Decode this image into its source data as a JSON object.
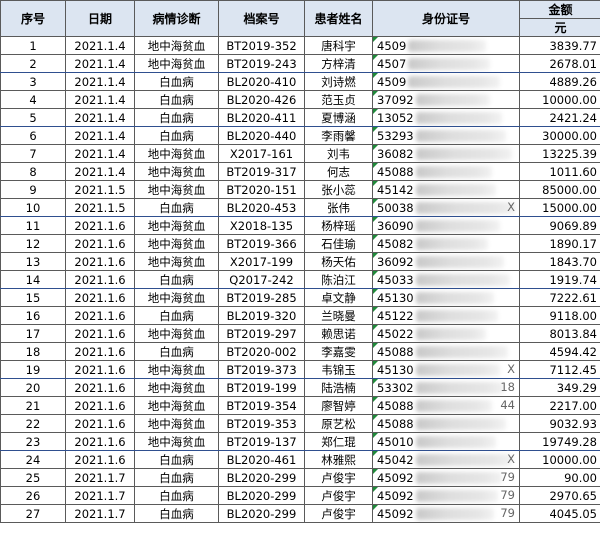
{
  "headers": {
    "seq": "序号",
    "date": "日期",
    "diagnosis": "病情诊断",
    "file_no": "档案号",
    "patient": "患者姓名",
    "id_number": "身份证号",
    "amount": "金额",
    "amount_unit": "元"
  },
  "rows": [
    {
      "seq": "1",
      "date": "2021.1.4",
      "diagnosis": "地中海贫血",
      "file_no": "BT2019-352",
      "patient": "唐科宇",
      "id_prefix": "4509",
      "id_tail": "",
      "amount": "3839.77"
    },
    {
      "seq": "2",
      "date": "2021.1.4",
      "diagnosis": "地中海贫血",
      "file_no": "BT2019-243",
      "patient": "方梓清",
      "id_prefix": "4507",
      "id_tail": "",
      "amount": "2678.01"
    },
    {
      "seq": "3",
      "date": "2021.1.4",
      "diagnosis": "白血病",
      "file_no": "BL2020-410",
      "patient": "刘诗燃",
      "id_prefix": "4509",
      "id_tail": "",
      "amount": "4889.26"
    },
    {
      "seq": "4",
      "date": "2021.1.4",
      "diagnosis": "白血病",
      "file_no": "BL2020-426",
      "patient": "范玉贞",
      "id_prefix": "37092",
      "id_tail": "",
      "amount": "10000.00"
    },
    {
      "seq": "5",
      "date": "2021.1.4",
      "diagnosis": "白血病",
      "file_no": "BL2020-411",
      "patient": "夏博涵",
      "id_prefix": "13052",
      "id_tail": "",
      "amount": "2421.24"
    },
    {
      "seq": "6",
      "date": "2021.1.4",
      "diagnosis": "白血病",
      "file_no": "BL2020-440",
      "patient": "李雨馨",
      "id_prefix": "53293",
      "id_tail": "",
      "amount": "30000.00"
    },
    {
      "seq": "7",
      "date": "2021.1.4",
      "diagnosis": "地中海贫血",
      "file_no": "X2017-161",
      "patient": "刘韦",
      "id_prefix": "36082",
      "id_tail": "",
      "amount": "13225.39"
    },
    {
      "seq": "8",
      "date": "2021.1.4",
      "diagnosis": "地中海贫血",
      "file_no": "BT2019-317",
      "patient": "何志",
      "id_prefix": "45088",
      "id_tail": "",
      "amount": "1011.60"
    },
    {
      "seq": "9",
      "date": "2021.1.5",
      "diagnosis": "地中海贫血",
      "file_no": "BT2020-151",
      "patient": "张小蕊",
      "id_prefix": "45142",
      "id_tail": "",
      "amount": "85000.00"
    },
    {
      "seq": "10",
      "date": "2021.1.5",
      "diagnosis": "白血病",
      "file_no": "BL2020-453",
      "patient": "张伟",
      "id_prefix": "50038",
      "id_tail": "X",
      "amount": "15000.00"
    },
    {
      "seq": "11",
      "date": "2021.1.6",
      "diagnosis": "地中海贫血",
      "file_no": "X2018-135",
      "patient": "杨梓瑶",
      "id_prefix": "36090",
      "id_tail": "",
      "amount": "9069.89"
    },
    {
      "seq": "12",
      "date": "2021.1.6",
      "diagnosis": "地中海贫血",
      "file_no": "BT2019-366",
      "patient": "石佳瑜",
      "id_prefix": "45082",
      "id_tail": "",
      "amount": "1890.17"
    },
    {
      "seq": "13",
      "date": "2021.1.6",
      "diagnosis": "地中海贫血",
      "file_no": "X2017-199",
      "patient": "杨天佑",
      "id_prefix": "36092",
      "id_tail": "",
      "amount": "1843.70"
    },
    {
      "seq": "14",
      "date": "2021.1.6",
      "diagnosis": "白血病",
      "file_no": "Q2017-242",
      "patient": "陈泊江",
      "id_prefix": "45033",
      "id_tail": "",
      "amount": "1919.74"
    },
    {
      "seq": "15",
      "date": "2021.1.6",
      "diagnosis": "地中海贫血",
      "file_no": "BT2019-285",
      "patient": "卓文静",
      "id_prefix": "45130",
      "id_tail": "",
      "amount": "7222.61"
    },
    {
      "seq": "16",
      "date": "2021.1.6",
      "diagnosis": "白血病",
      "file_no": "BL2019-320",
      "patient": "兰晓曼",
      "id_prefix": "45122",
      "id_tail": "",
      "amount": "9118.00"
    },
    {
      "seq": "17",
      "date": "2021.1.6",
      "diagnosis": "地中海贫血",
      "file_no": "BT2019-297",
      "patient": "赖思诺",
      "id_prefix": "45022",
      "id_tail": "",
      "amount": "8013.84"
    },
    {
      "seq": "18",
      "date": "2021.1.6",
      "diagnosis": "白血病",
      "file_no": "BT2020-002",
      "patient": "李嘉雯",
      "id_prefix": "45088",
      "id_tail": "",
      "amount": "4594.42"
    },
    {
      "seq": "19",
      "date": "2021.1.6",
      "diagnosis": "地中海贫血",
      "file_no": "BT2019-373",
      "patient": "韦锦玉",
      "id_prefix": "45130",
      "id_tail": "X",
      "amount": "7112.45"
    },
    {
      "seq": "20",
      "date": "2021.1.6",
      "diagnosis": "地中海贫血",
      "file_no": "BT2019-199",
      "patient": "陆浩楠",
      "id_prefix": "53302",
      "id_tail": "18",
      "amount": "349.29"
    },
    {
      "seq": "21",
      "date": "2021.1.6",
      "diagnosis": "地中海贫血",
      "file_no": "BT2019-354",
      "patient": "廖智婷",
      "id_prefix": "45088",
      "id_tail": "44",
      "amount": "2217.00"
    },
    {
      "seq": "22",
      "date": "2021.1.6",
      "diagnosis": "地中海贫血",
      "file_no": "BT2019-353",
      "patient": "原艺松",
      "id_prefix": "45088",
      "id_tail": "",
      "amount": "9032.93"
    },
    {
      "seq": "23",
      "date": "2021.1.6",
      "diagnosis": "地中海贫血",
      "file_no": "BT2019-137",
      "patient": "郑仁琨",
      "id_prefix": "45010",
      "id_tail": "",
      "amount": "19749.28"
    },
    {
      "seq": "24",
      "date": "2021.1.6",
      "diagnosis": "白血病",
      "file_no": "BL2020-461",
      "patient": "林雅熙",
      "id_prefix": "45042",
      "id_tail": "X",
      "amount": "10000.00"
    },
    {
      "seq": "25",
      "date": "2021.1.7",
      "diagnosis": "白血病",
      "file_no": "BL2020-299",
      "patient": "卢俊宇",
      "id_prefix": "45092",
      "id_tail": "79",
      "amount": "90.00"
    },
    {
      "seq": "26",
      "date": "2021.1.7",
      "diagnosis": "白血病",
      "file_no": "BL2020-299",
      "patient": "卢俊宇",
      "id_prefix": "45092",
      "id_tail": "79",
      "amount": "2970.65"
    },
    {
      "seq": "27",
      "date": "2021.1.7",
      "diagnosis": "白血病",
      "file_no": "BL2020-299",
      "patient": "卢俊宇",
      "id_prefix": "45092",
      "id_tail": "79",
      "amount": "4045.05"
    }
  ],
  "colors": {
    "header_bg": "#dce5f1",
    "grid_line": "#5a5a5a",
    "row_separator": "#2f4f8f",
    "comment_marker": "#1f8a3a"
  },
  "icons": {
    "comment_marker": "green-triangle-icon"
  }
}
